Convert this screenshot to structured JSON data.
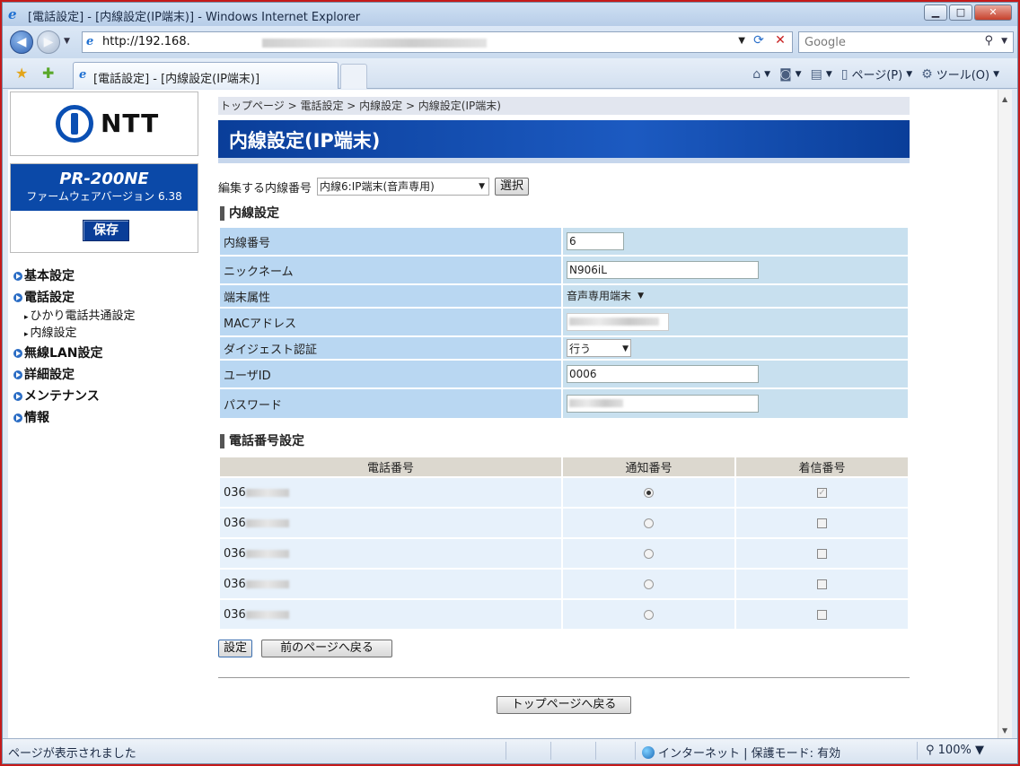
{
  "window": {
    "title": "[電話設定] - [内線設定(IP端末)] - Windows Internet Explorer",
    "minimize": "▁",
    "maximize": "□",
    "close": "✕"
  },
  "address": {
    "url": "http://192.168.",
    "search_placeholder": "Google"
  },
  "tab": {
    "label": "[電話設定] - [内線設定(IP端末)]"
  },
  "commandbar": {
    "page": "ページ(P)",
    "tools": "ツール(O)"
  },
  "sidebar": {
    "logo_text": "NTT",
    "model": "PR-200NE",
    "firmware": "ファームウェアバージョン 6.38",
    "save": "保存",
    "menu": [
      {
        "label": "基本設定"
      },
      {
        "label": "電話設定"
      },
      {
        "label": "ひかり電話共通設定"
      },
      {
        "label": "内線設定"
      },
      {
        "label": "無線LAN設定"
      },
      {
        "label": "詳細設定"
      },
      {
        "label": "メンテナンス"
      },
      {
        "label": "情報"
      }
    ]
  },
  "main": {
    "breadcrumb": "トップページ > 電話設定 > 内線設定 > 内線設定(IP端末)",
    "heading": "内線設定(IP端末)",
    "select_label": "編集する内線番号",
    "select_value": "内線6:IP端末(音声専用)",
    "select_button": "選択",
    "section1": "内線設定",
    "fields": {
      "ext_label": "内線番号",
      "ext_value": "6",
      "nick_label": "ニックネーム",
      "nick_value": "N906iL",
      "attr_label": "端末属性",
      "attr_value": "音声専用端末",
      "mac_label": "MACアドレス",
      "digest_label": "ダイジェスト認証",
      "digest_value": "行う",
      "user_label": "ユーザID",
      "user_value": "0006",
      "pass_label": "パスワード"
    },
    "section2": "電話番号設定",
    "phone_headers": {
      "number": "電話番号",
      "notify": "通知番号",
      "incoming": "着信番号"
    },
    "phone_rows": [
      {
        "prefix": "036",
        "notify_selected": true,
        "incoming_checked": true
      },
      {
        "prefix": "036",
        "notify_selected": false,
        "incoming_checked": false
      },
      {
        "prefix": "036",
        "notify_selected": false,
        "incoming_checked": false
      },
      {
        "prefix": "036",
        "notify_selected": false,
        "incoming_checked": false
      },
      {
        "prefix": "036",
        "notify_selected": false,
        "incoming_checked": false
      }
    ],
    "set_button": "設定",
    "back_button": "前のページへ戻る",
    "top_button": "トップページへ戻る"
  },
  "status": {
    "message": "ページが表示されました",
    "zone": "インターネット | 保護モード: 有効",
    "zoom": "100%"
  }
}
